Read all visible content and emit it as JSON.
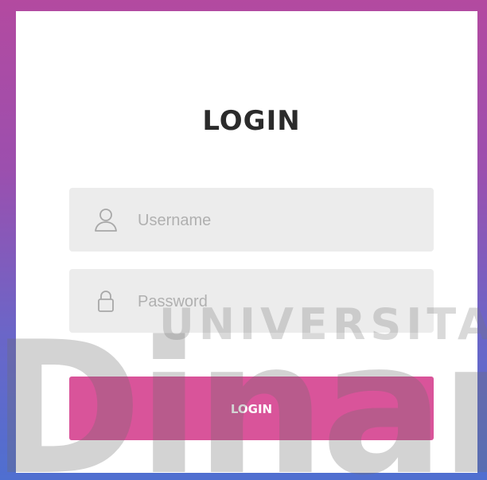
{
  "login": {
    "title": "LOGIN",
    "username_placeholder": "Username",
    "password_placeholder": "Password",
    "button_label": "LOGIN"
  },
  "watermark": {
    "line1": "UNIVERSITA",
    "line2": "Dinam"
  },
  "icons": [
    "user-icon",
    "lock-icon"
  ],
  "colors": {
    "button": "#d9549a",
    "field_bg": "#ececec",
    "title": "#2b2b2b",
    "gradient_top": "#b34aa0",
    "gradient_bottom": "#4f6fd0"
  }
}
